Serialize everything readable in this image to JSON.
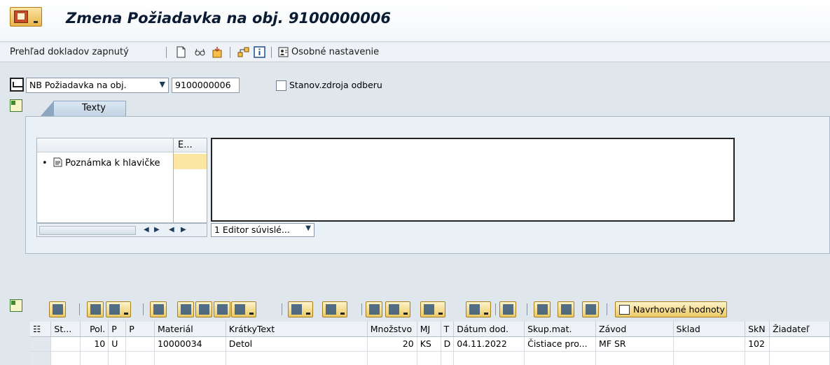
{
  "window": {
    "title": "Zmena Požiadavka na obj. 9100000006"
  },
  "toolbar": {
    "doc_overview_label": "Prehľad dokladov zapnutý",
    "personal_settings_label": "Osobné nastavenie",
    "icons": [
      "new-document-icon",
      "glasses-display-icon",
      "other-document-icon",
      "tree-icon",
      "info-icon",
      "personal-settings-icon"
    ]
  },
  "header": {
    "doc_type": "NB Požiadavka na obj.",
    "doc_number": "9100000006",
    "source_determination_label": "Stanov.zdroja odberu",
    "source_determination_checked": false
  },
  "tabs": {
    "texts_label": "Texty"
  },
  "text_tree": {
    "col2_header": "E...",
    "item_label": "Poznámka k hlavičke",
    "editor_mode": "1 Editor súvislé..."
  },
  "alv": {
    "suggested_values_label": "Navrhované hodnoty",
    "columns": [
      "St...",
      "Pol.",
      "P",
      "P",
      "Materiál",
      "KrátkyText",
      "Množstvo",
      "MJ",
      "T",
      "Dátum dod.",
      "Skup.mat.",
      "Závod",
      "Sklad",
      "SkN",
      "Žiadateľ"
    ],
    "rows": [
      {
        "status": "",
        "item": "10",
        "p1": "U",
        "p2": "",
        "material": "10000034",
        "short_text": "Detol",
        "quantity": "20",
        "unit": "KS",
        "t": "D",
        "delivery_date": "04.11.2022",
        "mat_group": "Čistiace pro...",
        "plant": "MF SR",
        "storage": "",
        "skn": "102",
        "requester": ""
      }
    ]
  },
  "colors": {
    "title_text": "#0a1c34",
    "highlight": "#fbe7a3",
    "button_gold": "#ecc963"
  }
}
